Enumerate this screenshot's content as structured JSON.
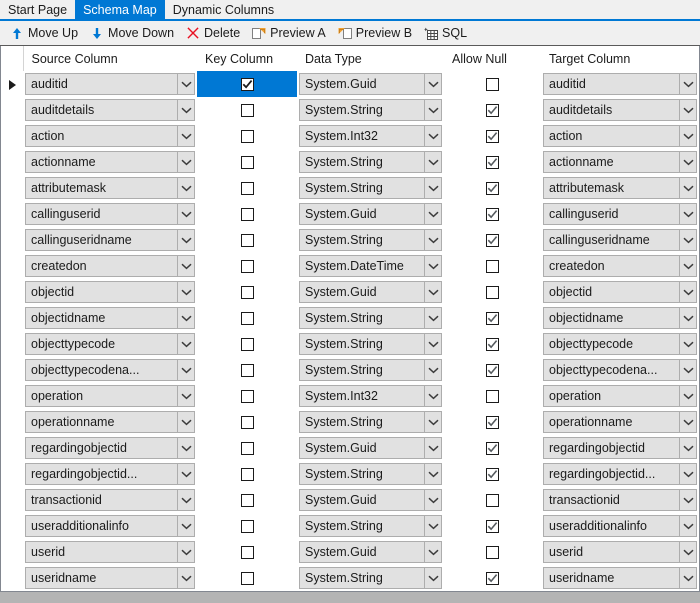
{
  "window": {
    "title": "Schema Map"
  },
  "tabs": [
    {
      "label": "Start Page",
      "active": false
    },
    {
      "label": "Schema Map",
      "active": true
    },
    {
      "label": "Dynamic Columns",
      "active": false
    }
  ],
  "toolbar": {
    "buttons": [
      {
        "label": "Move Up",
        "icon": "arrow-up-icon",
        "color": "#0078d4"
      },
      {
        "label": "Move Down",
        "icon": "arrow-down-icon",
        "color": "#0078d4"
      },
      {
        "label": "Delete",
        "icon": "x-delete-icon",
        "color": "#e81123"
      },
      {
        "label": "Preview A",
        "icon": "preview-a-icon",
        "color": "#f0a030"
      },
      {
        "label": "Preview B",
        "icon": "preview-b-icon",
        "color": "#f0a030"
      },
      {
        "label": "SQL",
        "icon": "sql-grid-icon",
        "color": "#4a4a4a"
      }
    ]
  },
  "grid": {
    "columns": [
      {
        "key": "selector",
        "label": ""
      },
      {
        "key": "source_column",
        "label": "Source Column"
      },
      {
        "key": "key_column",
        "label": "Key Column"
      },
      {
        "key": "data_type",
        "label": "Data Type"
      },
      {
        "key": "allow_null",
        "label": "Allow Null"
      },
      {
        "key": "target_column",
        "label": "Target Column"
      }
    ],
    "selected_row": 0,
    "rows": [
      {
        "source_column": "auditid",
        "key_column": true,
        "data_type": "System.Guid",
        "allow_null": false,
        "target_column": "auditid"
      },
      {
        "source_column": "auditdetails",
        "key_column": false,
        "data_type": "System.String",
        "allow_null": true,
        "target_column": "auditdetails"
      },
      {
        "source_column": "action",
        "key_column": false,
        "data_type": "System.Int32",
        "allow_null": true,
        "target_column": "action"
      },
      {
        "source_column": "actionname",
        "key_column": false,
        "data_type": "System.String",
        "allow_null": true,
        "target_column": "actionname"
      },
      {
        "source_column": "attributemask",
        "key_column": false,
        "data_type": "System.String",
        "allow_null": true,
        "target_column": "attributemask"
      },
      {
        "source_column": "callinguserid",
        "key_column": false,
        "data_type": "System.Guid",
        "allow_null": true,
        "target_column": "callinguserid"
      },
      {
        "source_column": "callinguseridname",
        "key_column": false,
        "data_type": "System.String",
        "allow_null": true,
        "target_column": "callinguseridname"
      },
      {
        "source_column": "createdon",
        "key_column": false,
        "data_type": "System.DateTime",
        "allow_null": false,
        "target_column": "createdon"
      },
      {
        "source_column": "objectid",
        "key_column": false,
        "data_type": "System.Guid",
        "allow_null": false,
        "target_column": "objectid"
      },
      {
        "source_column": "objectidname",
        "key_column": false,
        "data_type": "System.String",
        "allow_null": true,
        "target_column": "objectidname"
      },
      {
        "source_column": "objecttypecode",
        "key_column": false,
        "data_type": "System.String",
        "allow_null": true,
        "target_column": "objecttypecode"
      },
      {
        "source_column": "objecttypecodena...",
        "key_column": false,
        "data_type": "System.String",
        "allow_null": true,
        "target_column": "objecttypecodena..."
      },
      {
        "source_column": "operation",
        "key_column": false,
        "data_type": "System.Int32",
        "allow_null": false,
        "target_column": "operation"
      },
      {
        "source_column": "operationname",
        "key_column": false,
        "data_type": "System.String",
        "allow_null": true,
        "target_column": "operationname"
      },
      {
        "source_column": "regardingobjectid",
        "key_column": false,
        "data_type": "System.Guid",
        "allow_null": true,
        "target_column": "regardingobjectid"
      },
      {
        "source_column": "regardingobjectid...",
        "key_column": false,
        "data_type": "System.String",
        "allow_null": true,
        "target_column": "regardingobjectid..."
      },
      {
        "source_column": "transactionid",
        "key_column": false,
        "data_type": "System.Guid",
        "allow_null": false,
        "target_column": "transactionid"
      },
      {
        "source_column": "useradditionalinfo",
        "key_column": false,
        "data_type": "System.String",
        "allow_null": true,
        "target_column": "useradditionalinfo"
      },
      {
        "source_column": "userid",
        "key_column": false,
        "data_type": "System.Guid",
        "allow_null": false,
        "target_column": "userid"
      },
      {
        "source_column": "useridname",
        "key_column": false,
        "data_type": "System.String",
        "allow_null": true,
        "target_column": "useridname"
      }
    ]
  },
  "colors": {
    "accent": "#0078d4",
    "delete": "#e81123",
    "preview": "#f0a030",
    "grid_line": "#d4d4d4",
    "cell_fill": "#e1e1e1",
    "chrome": "#f0f0f0"
  }
}
